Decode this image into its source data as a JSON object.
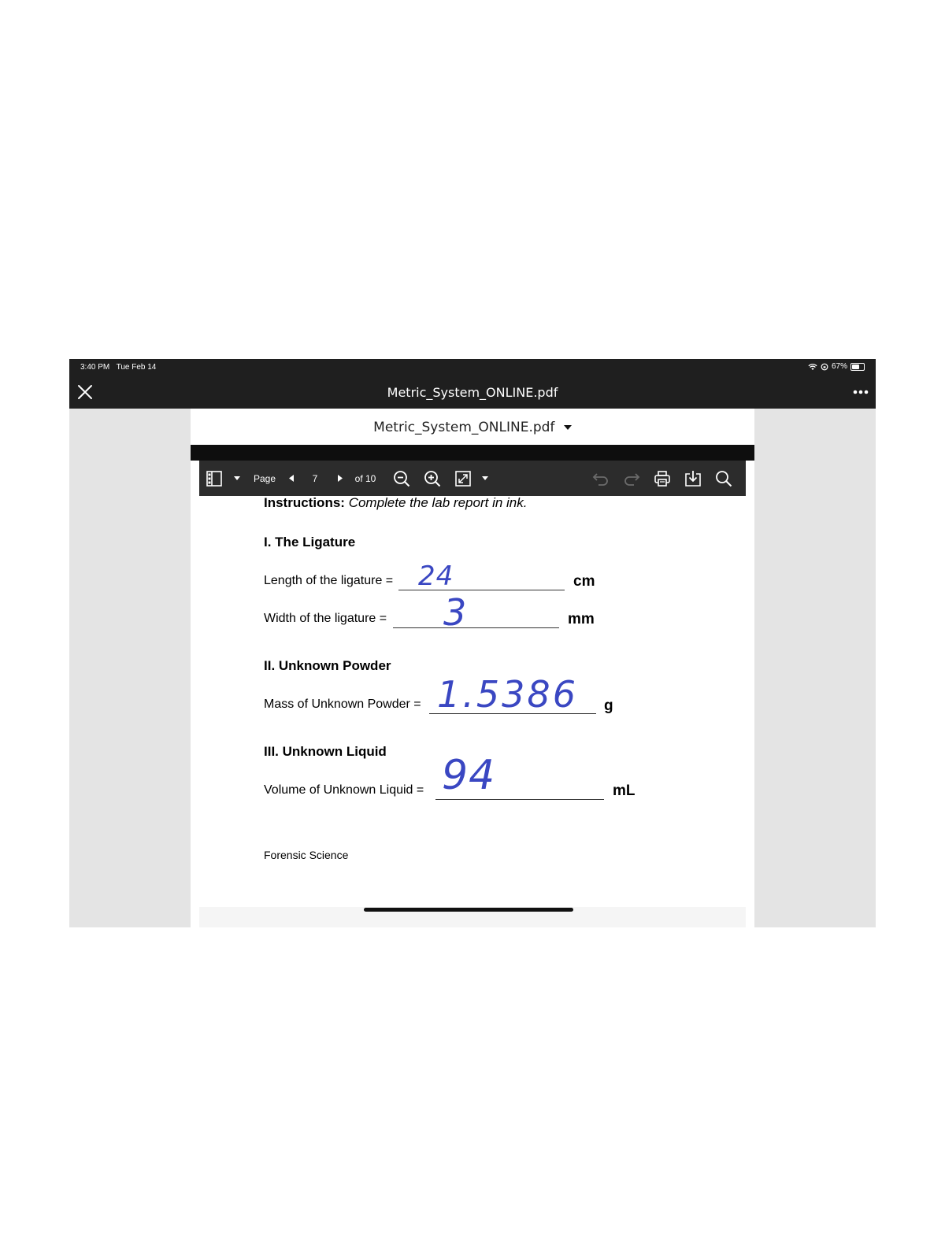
{
  "status_bar": {
    "time": "3:40 PM",
    "date": "Tue Feb 14",
    "battery_percent": "67%",
    "battery_level": 0.67
  },
  "app_bar": {
    "title": "Metric_System_ONLINE.pdf"
  },
  "viewer": {
    "file_name": "Metric_System_ONLINE.pdf",
    "toolbar": {
      "page_label": "Page",
      "current_page": "7",
      "page_count_label": "of 10"
    }
  },
  "document": {
    "instructions_bold": "Instructions:",
    "instructions_text": "Complete the lab report in ink.",
    "section1": {
      "heading": "I. The Ligature",
      "length_label": "Length of the ligature =",
      "length_value": "24",
      "length_unit": "cm",
      "width_label": "Width of the ligature =",
      "width_value": "3",
      "width_unit": "mm"
    },
    "section2": {
      "heading": "II. Unknown Powder",
      "mass_label": "Mass of Unknown Powder =",
      "mass_value": "1.5386",
      "mass_unit": "g"
    },
    "section3": {
      "heading": "III. Unknown Liquid",
      "volume_label": "Volume of Unknown Liquid =",
      "volume_value": "94",
      "volume_unit": "mL"
    },
    "footer": "Forensic Science"
  },
  "colors": {
    "chrome_dark": "#1f1f1f",
    "toolbar": "#2c2c2c",
    "ink": "#3a47c2",
    "gutter": "#e4e4e4"
  }
}
